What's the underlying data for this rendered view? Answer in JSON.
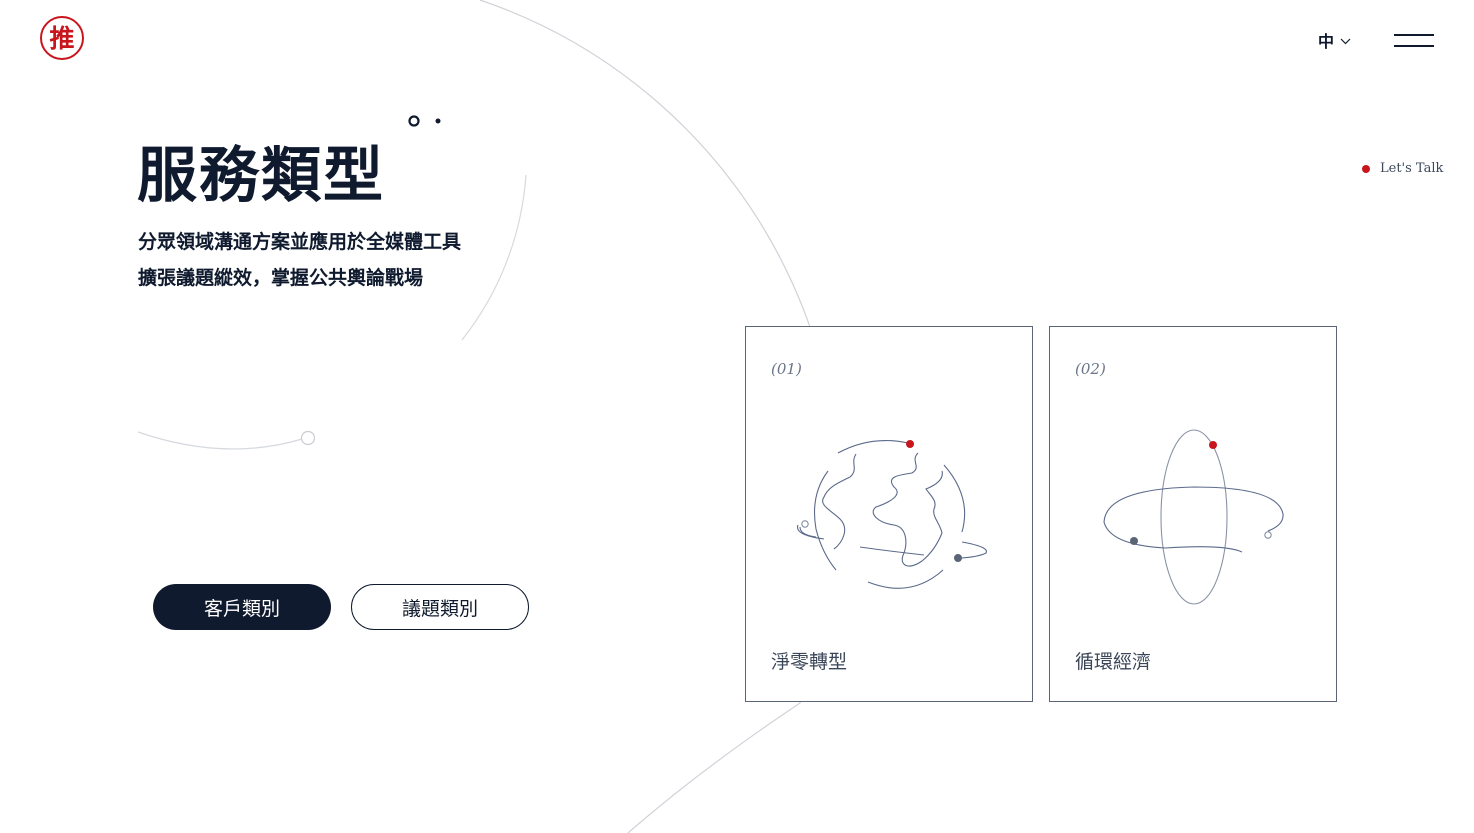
{
  "header": {
    "logo_char": "推",
    "language": "中",
    "lets_talk": "Let's Talk"
  },
  "hero": {
    "title": "服務類型",
    "subtitle_line1": "分眾領域溝通方案並應用於全媒體工具",
    "subtitle_line2": "擴張議題縱效，掌握公共輿論戰場"
  },
  "tabs": [
    {
      "label": "客戶類別",
      "active": true
    },
    {
      "label": "議題類別",
      "active": false
    }
  ],
  "cards": [
    {
      "number": "(01)",
      "title": "淨零轉型",
      "icon": "globe-icon"
    },
    {
      "number": "(02)",
      "title": "循環經濟",
      "icon": "orbit-icon"
    }
  ],
  "colors": {
    "navy": "#0f1a2e",
    "accent_red": "#c8161d",
    "line_gray": "#c9ccd3"
  }
}
